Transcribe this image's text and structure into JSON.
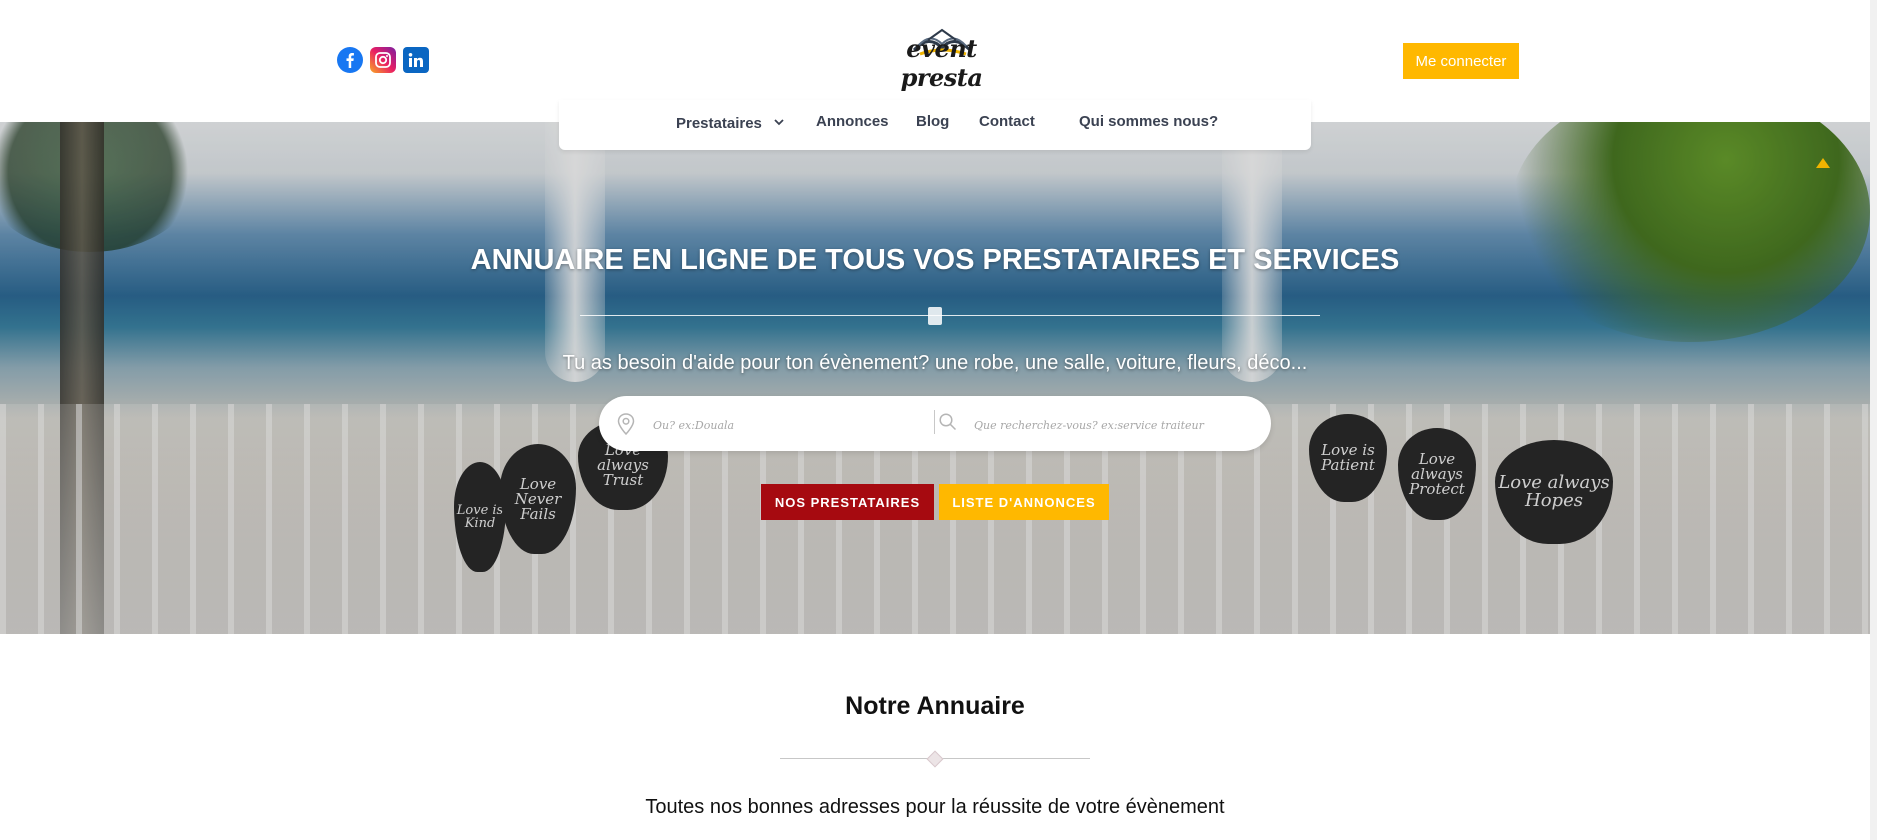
{
  "header": {
    "socials": [
      "facebook-icon",
      "instagram-icon",
      "linkedin-icon"
    ],
    "logo_text": "event presta",
    "login_label": "Me connecter"
  },
  "nav": {
    "items": [
      {
        "label": "Prestataires",
        "has_dropdown": true
      },
      {
        "label": "Annonces"
      },
      {
        "label": "Blog"
      },
      {
        "label": "Contact"
      },
      {
        "label": "Qui sommes nous?"
      }
    ]
  },
  "hero": {
    "title": "ANNUAIRE EN LIGNE DE TOUS VOS PRESTATAIRES ET SERVICES",
    "subtitle": "Tu as besoin d'aide pour ton évènement? une robe, une salle, voiture, fleurs, déco...",
    "search": {
      "location_placeholder": "Ou? ex:Douala",
      "query_placeholder": "Que recherchez-vous? ex:service traiteur"
    },
    "buttons": {
      "prestataires": "NOS PRESTATAIRES",
      "annonces": "LISTE D'ANNONCES"
    },
    "hearts": [
      "Love is Kind",
      "Love Never Fails",
      "Love always Trust",
      "Love is Patient",
      "Love always Protect",
      "Love always Hopes"
    ]
  },
  "annuaire": {
    "title": "Notre Annuaire",
    "subtitle": "Toutes nos bonnes adresses pour la réussite de votre évènement"
  },
  "colors": {
    "accent_yellow": "#ffb800",
    "accent_red": "#a60a10",
    "nav_text": "#3b4252"
  }
}
